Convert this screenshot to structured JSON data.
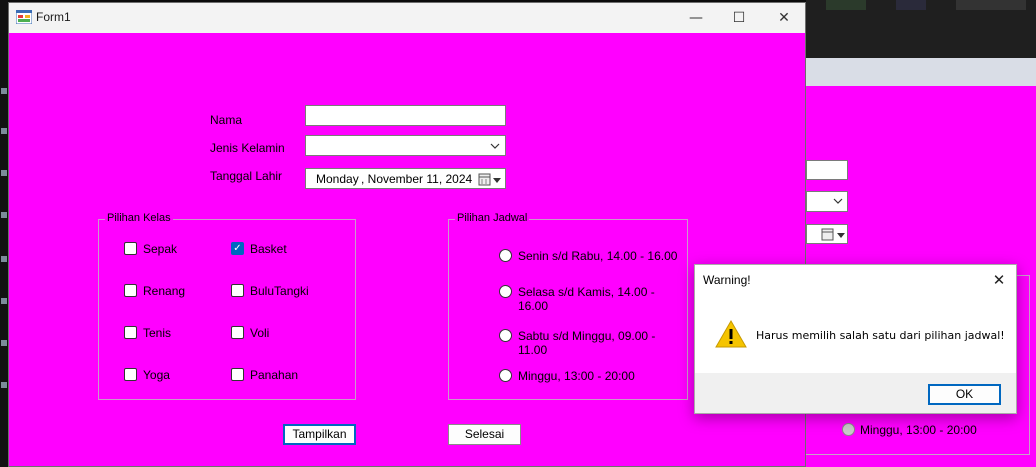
{
  "window": {
    "title": "Form1",
    "minimize": "—",
    "maximize": "☐",
    "close": "✕"
  },
  "form": {
    "nama_label": "Nama",
    "nama_value": "",
    "gender_label": "Jenis Kelamin",
    "gender_value": "",
    "tanggal_label": "Tanggal Lahir",
    "tanggal_day": "Monday",
    "tanggal_date": ",  November 11, 2024"
  },
  "pilihan_kelas": {
    "title": "Pilihan Kelas",
    "items": [
      {
        "label": "Sepak",
        "checked": false
      },
      {
        "label": "Basket",
        "checked": true
      },
      {
        "label": "Renang",
        "checked": false
      },
      {
        "label": "BuluTangki",
        "checked": false
      },
      {
        "label": "Tenis",
        "checked": false
      },
      {
        "label": "Voli",
        "checked": false
      },
      {
        "label": "Yoga",
        "checked": false
      },
      {
        "label": "Panahan",
        "checked": false
      }
    ]
  },
  "pilihan_jadwal": {
    "title": "Pilihan Jadwal",
    "options": [
      "Senin s/d Rabu, 14.00 - 16.00",
      "Selasa s/d Kamis, 14.00 - 16.00",
      "Sabtu s/d Minggu, 09.00 - 11.00",
      "Minggu, 13:00 -  20:00"
    ]
  },
  "buttons": {
    "tampilkan": "Tampilkan",
    "selesai": "Selesai"
  },
  "dialog": {
    "title": "Warning!",
    "message": "Harus memilih salah satu dari pilihan jadwal!",
    "ok": "OK",
    "close": "✕"
  },
  "background_window": {
    "radio_label": "Minggu, 13:00 -  20:00"
  },
  "colors": {
    "form_bg": "#ff00ff",
    "accent": "#0067c0",
    "warning_icon": "#f5c400"
  }
}
